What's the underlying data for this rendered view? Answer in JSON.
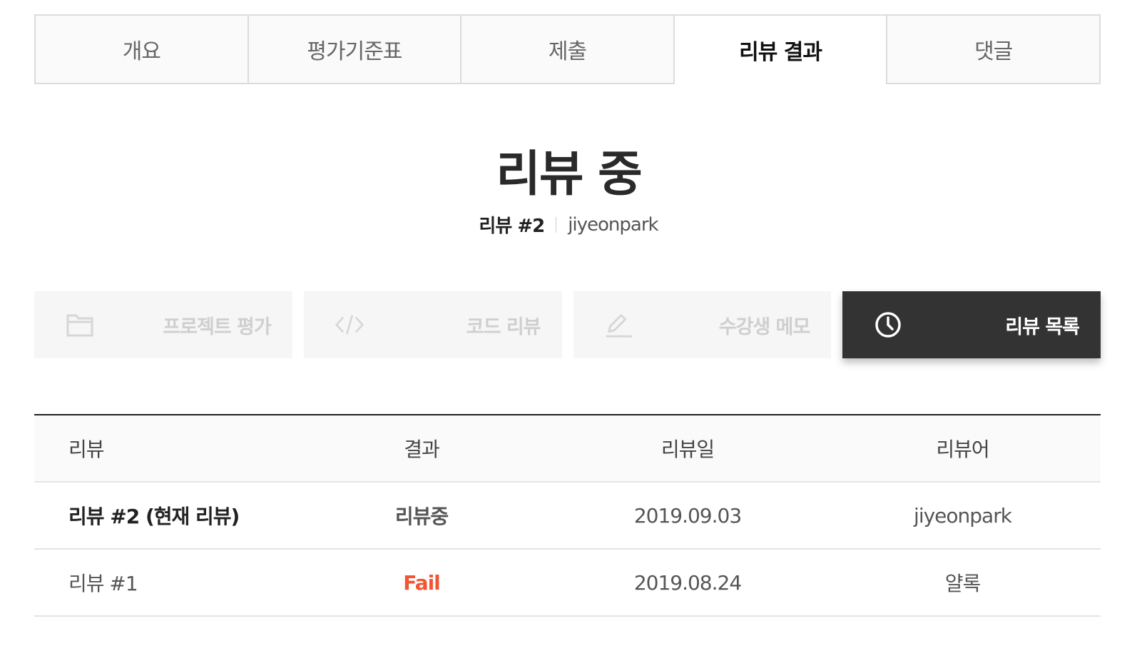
{
  "tabs": [
    {
      "label": "개요",
      "active": false
    },
    {
      "label": "평가기준표",
      "active": false
    },
    {
      "label": "제출",
      "active": false
    },
    {
      "label": "리뷰 결과",
      "active": true
    },
    {
      "label": "댓글",
      "active": false
    }
  ],
  "header": {
    "status_title": "리뷰 중",
    "review_number": "리뷰 #2",
    "reviewer": "jiyeonpark"
  },
  "actions": [
    {
      "label": "프로젝트 평가",
      "icon": "folder-icon",
      "active": false
    },
    {
      "label": "코드 리뷰",
      "icon": "code-icon",
      "active": false
    },
    {
      "label": "수강생 메모",
      "icon": "pencil-icon",
      "active": false
    },
    {
      "label": "리뷰 목록",
      "icon": "clock-icon",
      "active": true
    }
  ],
  "table": {
    "headers": [
      "리뷰",
      "결과",
      "리뷰일",
      "리뷰어"
    ],
    "rows": [
      {
        "review": "리뷰 #2 (현재 리뷰)",
        "result": "리뷰중",
        "date": "2019.09.03",
        "reviewer": "jiyeonpark",
        "current": true
      },
      {
        "review": "리뷰 #1",
        "result": "Fail",
        "date": "2019.08.24",
        "reviewer": "얄록",
        "current": false
      }
    ]
  },
  "colors": {
    "fail": "#f25533",
    "active_button": "#333333",
    "tab_border": "#dcdcdc"
  }
}
